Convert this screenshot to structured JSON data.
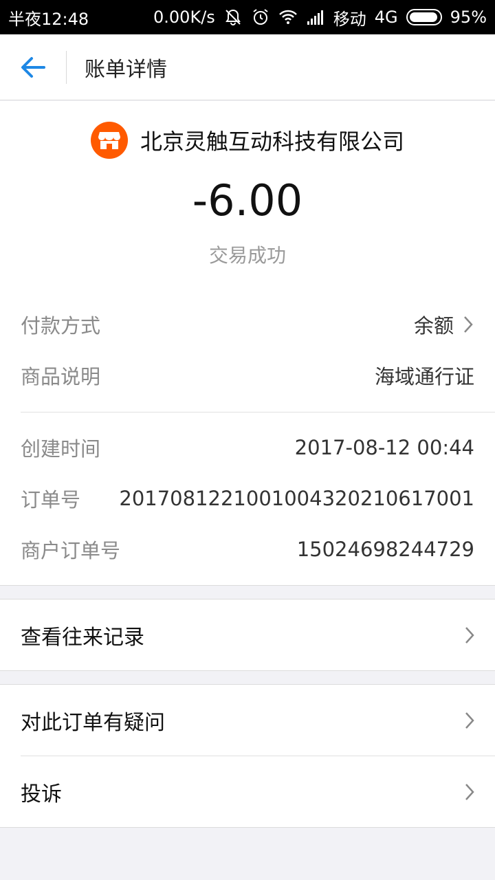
{
  "status_bar": {
    "time": "半夜12:48",
    "net_speed": "0.00K/s",
    "carrier": "移动",
    "network": "4G",
    "battery": "95%",
    "battery_level": 0.95,
    "icons": [
      "mute-bell-icon",
      "alarm-icon",
      "wifi-icon",
      "signal-icon",
      "battery-icon"
    ]
  },
  "header": {
    "title": "账单详情",
    "back_icon": "back-arrow-icon"
  },
  "bill": {
    "merchant_name": "北京灵触互动科技有限公司",
    "merchant_icon": "shop-icon",
    "amount": "-6.00",
    "status": "交易成功",
    "details": [
      {
        "label": "付款方式",
        "value": "余额"
      },
      {
        "label": "商品说明",
        "value": "海域通行证"
      },
      {
        "label": "创建时间",
        "value": "2017-08-12 00:44"
      },
      {
        "label": "订单号",
        "value": "2017081221001004320210617001"
      },
      {
        "label": "商户订单号",
        "value": "15024698244729"
      }
    ]
  },
  "actions": {
    "history": "查看往来记录",
    "question": "对此订单有疑问",
    "complain": "投诉"
  },
  "colors": {
    "accent": "#1e88e5",
    "merchant_logo": "#ff5a00",
    "background": "#f2f2f6"
  }
}
